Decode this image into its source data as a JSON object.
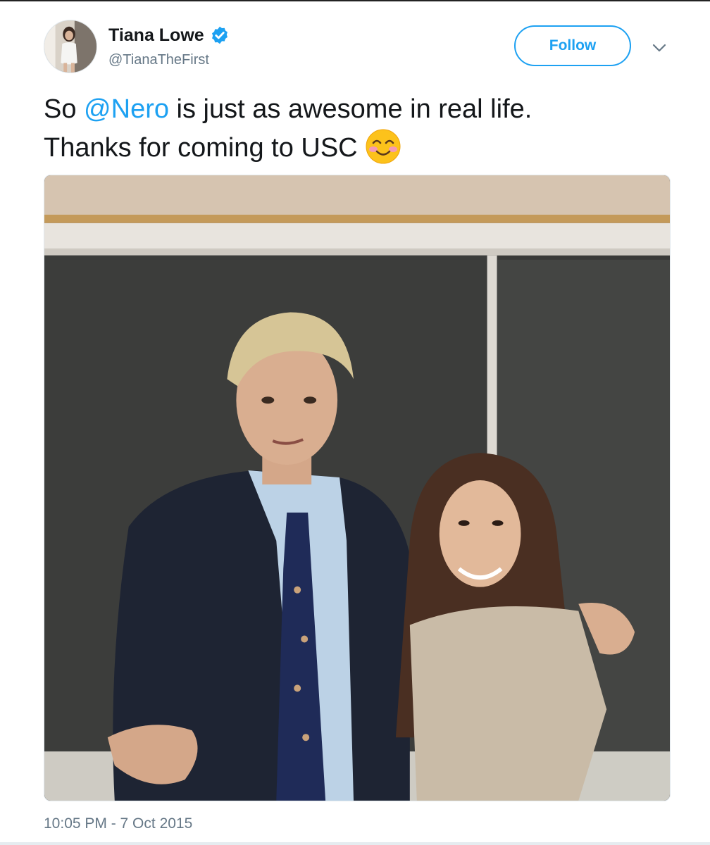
{
  "user": {
    "display_name": "Tiana Lowe",
    "handle": "@TianaTheFirst",
    "verified_icon": "verified-badge-icon"
  },
  "follow_button": {
    "label": "Follow"
  },
  "menu": {
    "icon": "chevron-down-icon"
  },
  "tweet": {
    "text_part1": "So ",
    "mention": "@Nero",
    "text_part2": " is just as awesome in real life.",
    "text_line2": "Thanks for coming to USC",
    "emoji": "smiling-face-with-blush-icon"
  },
  "media": {
    "type": "photo"
  },
  "timestamp": "10:05 PM - 7 Oct 2015",
  "colors": {
    "accent": "#1da1f2",
    "text_primary": "#14171a",
    "text_secondary": "#657786"
  }
}
